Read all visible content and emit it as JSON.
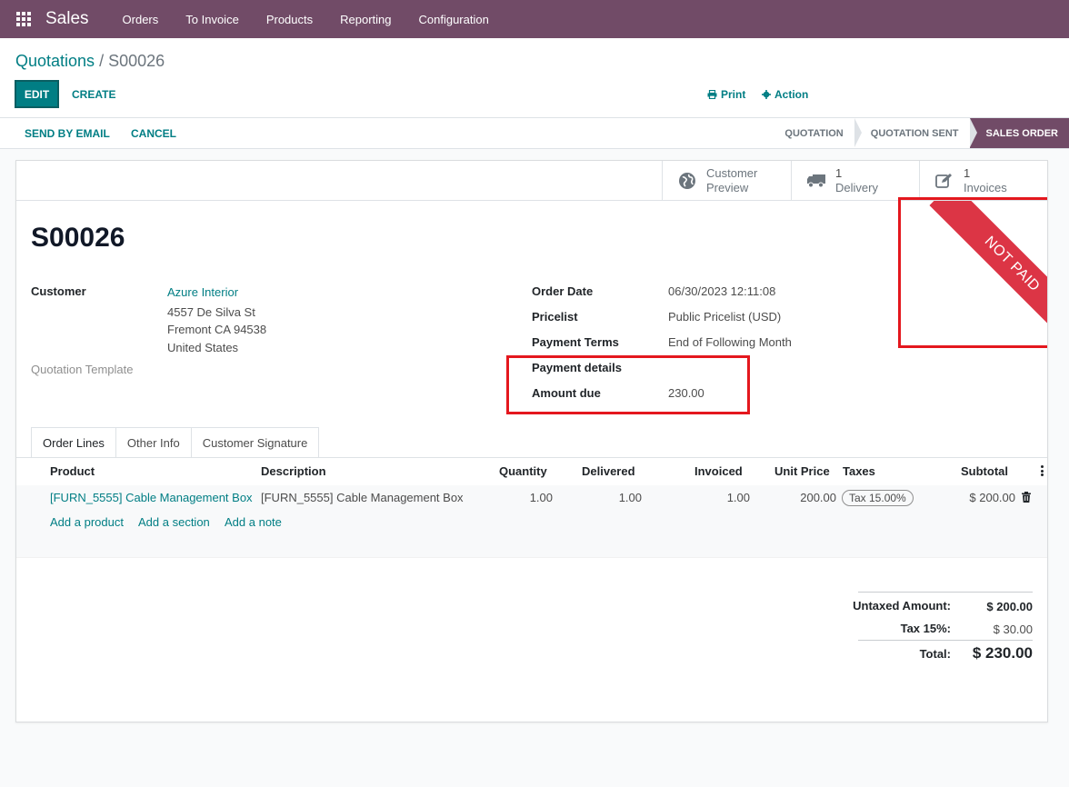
{
  "topbar": {
    "app_name": "Sales",
    "menu": [
      "Orders",
      "To Invoice",
      "Products",
      "Reporting",
      "Configuration"
    ]
  },
  "breadcrumb": {
    "parent": "Quotations",
    "separator": "/",
    "current": "S00026"
  },
  "control": {
    "edit_label": "EDIT",
    "create_label": "CREATE",
    "print_label": "Print",
    "action_label": "Action"
  },
  "statusbar": {
    "send_email_label": "SEND BY EMAIL",
    "cancel_label": "CANCEL",
    "stages": [
      "QUOTATION",
      "QUOTATION SENT",
      "SALES ORDER"
    ],
    "active_stage": "SALES ORDER"
  },
  "smart_buttons": {
    "preview": {
      "line1": "Customer",
      "line2": "Preview"
    },
    "delivery": {
      "count": "1",
      "label": "Delivery"
    },
    "invoices": {
      "count": "1",
      "label": "Invoices"
    }
  },
  "ribbon": {
    "text": "NOT PAID",
    "color": "#dc3545"
  },
  "record": {
    "name": "S00026",
    "customer_label": "Customer",
    "customer_name": "Azure Interior",
    "customer_address": [
      "4557 De Silva St",
      "Fremont CA 94538",
      "United States"
    ],
    "quotation_template_label": "Quotation Template",
    "order_date_label": "Order Date",
    "order_date": "06/30/2023 12:11:08",
    "pricelist_label": "Pricelist",
    "pricelist": "Public Pricelist (USD)",
    "payment_terms_label": "Payment Terms",
    "payment_terms": "End of Following Month",
    "payment_details_label": "Payment details",
    "amount_due_label": "Amount due",
    "amount_due": "230.00"
  },
  "tabs": [
    "Order Lines",
    "Other Info",
    "Customer Signature"
  ],
  "order_lines": {
    "headers": {
      "product": "Product",
      "description": "Description",
      "quantity": "Quantity",
      "delivered": "Delivered",
      "invoiced": "Invoiced",
      "unit_price": "Unit Price",
      "taxes": "Taxes",
      "subtotal": "Subtotal"
    },
    "rows": [
      {
        "product": "[FURN_5555] Cable Management Box",
        "description": "[FURN_5555] Cable Management Box",
        "quantity": "1.00",
        "delivered": "1.00",
        "invoiced": "1.00",
        "unit_price": "200.00",
        "tax": "Tax 15.00%",
        "subtotal": "$ 200.00"
      }
    ],
    "add_product": "Add a product",
    "add_section": "Add a section",
    "add_note": "Add a note"
  },
  "totals": {
    "untaxed_label": "Untaxed Amount:",
    "untaxed_value": "$ 200.00",
    "tax_label": "Tax 15%:",
    "tax_value": "$ 30.00",
    "total_label": "Total:",
    "total_value": "$ 230.00"
  },
  "colors": {
    "brand": "#714b67",
    "accent": "#017e84",
    "highlight": "#e4171e"
  }
}
